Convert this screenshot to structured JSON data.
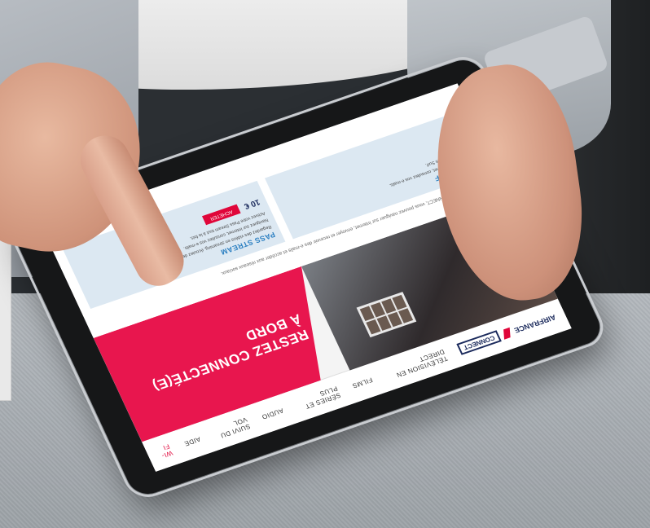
{
  "screen": {
    "brand": "AIRFRANCE",
    "brand_logo_text": "CONNECT",
    "nav": [
      {
        "label": "TÉLÉVISION EN DIRECT",
        "active": false
      },
      {
        "label": "FILMS",
        "active": false
      },
      {
        "label": "SÉRIES ET PLUS",
        "active": false
      },
      {
        "label": "AUDIO",
        "active": false
      },
      {
        "label": "SUIVI DU VOL",
        "active": false
      },
      {
        "label": "AIDE",
        "active": false
      },
      {
        "label": "WI-FI",
        "active": true
      }
    ],
    "hero": {
      "title_line1": "RESTEZ CONNECTÉ(E)",
      "title_line2": "À BORD"
    },
    "wifi": {
      "title": "WI-FI",
      "intro": "Avec les Pass Wi-Fi CONNECT, vous pouvez naviguer sur Internet, envoyer et recevoir des e-mails et accéder aux réseaux sociaux.",
      "passes": [
        {
          "title": "PASS SURF",
          "lines": [
            "Naviguez sur Internet, consultez vos e-mails.",
            "Activez votre Pass Surf."
          ]
        },
        {
          "title": "PASS STREAM",
          "lines": [
            "Regardez des vidéos en streaming, écoutez de la musique.",
            "Naviguez sur Internet, consultez vos e-mails.",
            "Activez votre Pass Stream tout à la fois."
          ],
          "price": "10 €",
          "button": "ACHETER"
        }
      ]
    }
  },
  "colors": {
    "accent_pink": "#e8164e",
    "brand_navy": "#1b2a5c",
    "pass_blue": "#2b7fc1"
  }
}
